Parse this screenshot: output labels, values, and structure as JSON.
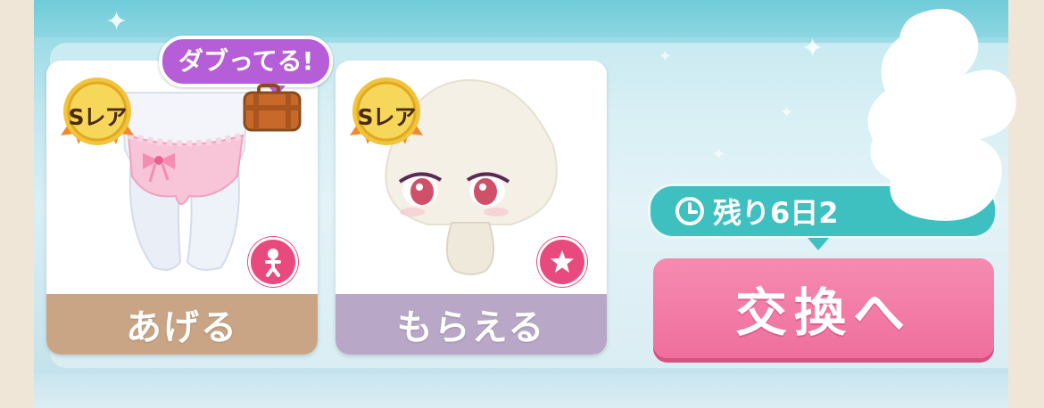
{
  "give_card": {
    "label": "あげる",
    "rarity": "Sレア",
    "duplicate_tag": "ダブってる!",
    "category_icon": "person-icon"
  },
  "get_card": {
    "label": "もらえる",
    "rarity": "Sレア",
    "category_icon": "star-icon"
  },
  "timer": {
    "text": "残り6日2"
  },
  "exchange": {
    "label": "交換へ"
  },
  "colors": {
    "accent_pink": "#ef6f9c",
    "teal": "#3fc0c0",
    "duplicate_purple": "#b65ed8",
    "give_brown": "#c9a585",
    "get_lavender": "#b9a7c8"
  }
}
